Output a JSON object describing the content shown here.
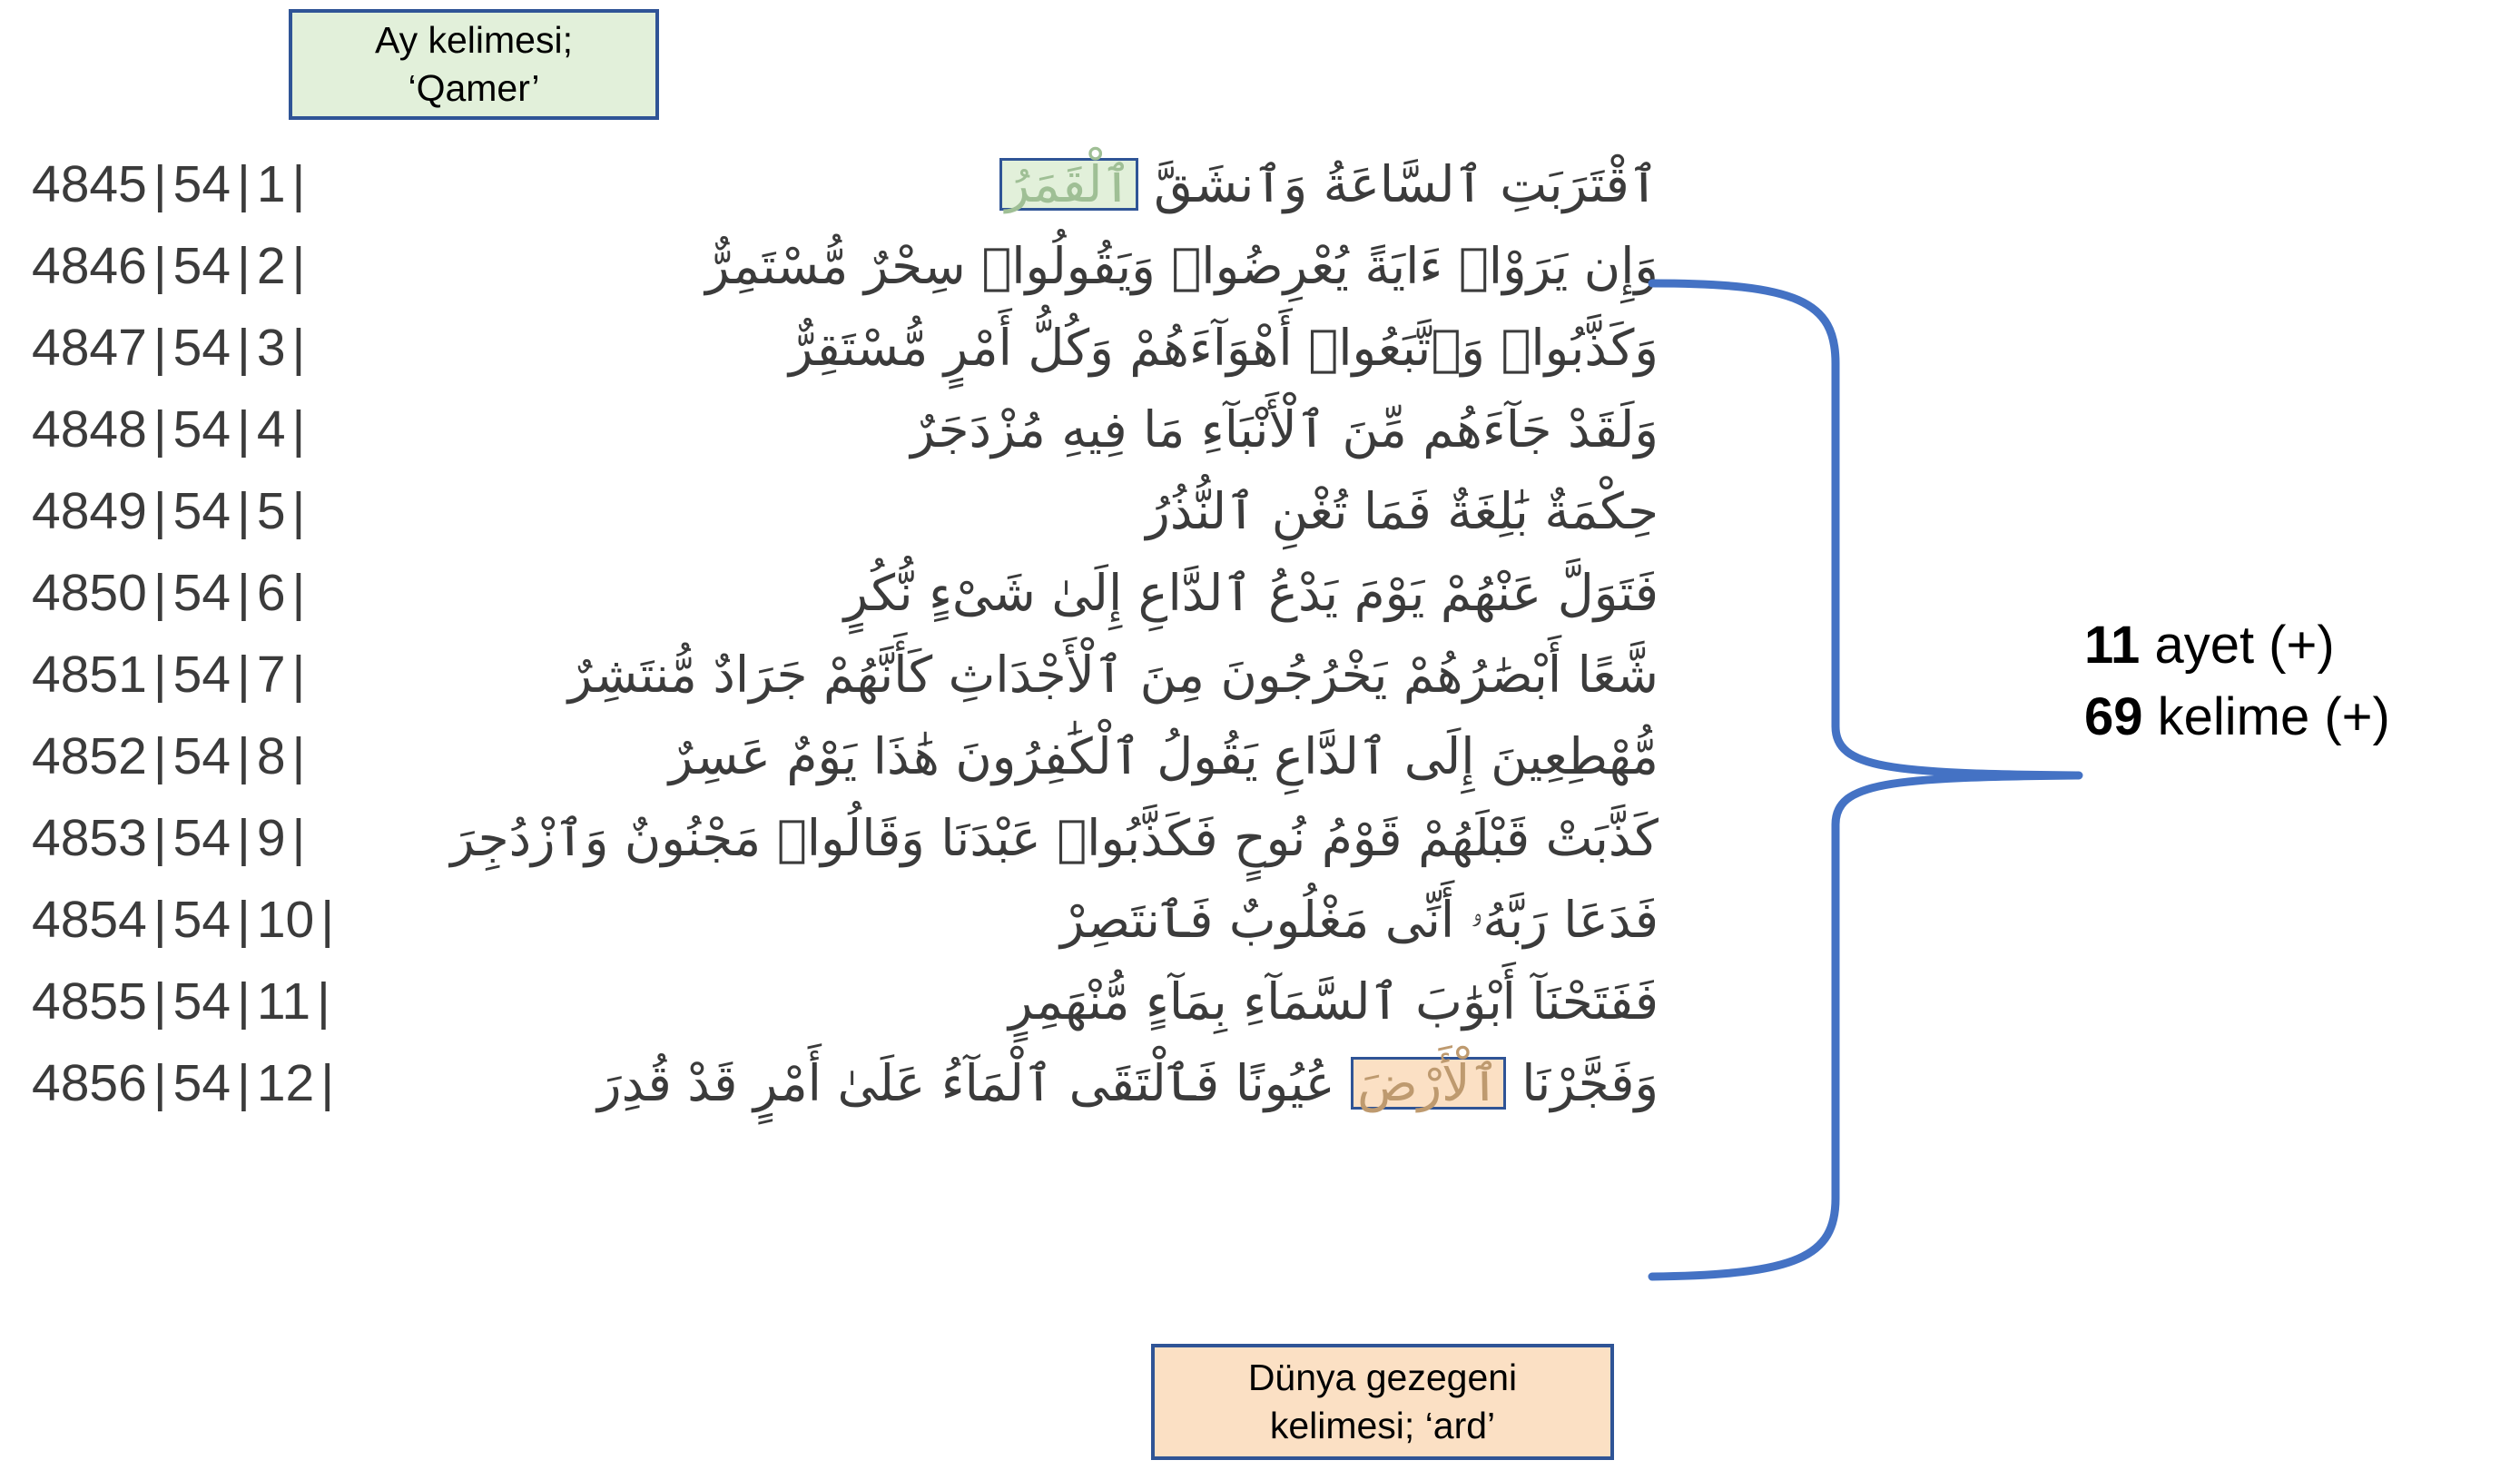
{
  "callouts": {
    "moon": {
      "line1": "Ay kelimesi;",
      "line2": "‘Qamer’",
      "fill": "#E2F0DA",
      "border": "#2F5496"
    },
    "earth": {
      "line1": "Dünya gezegeni",
      "line2": "kelimesi; ‘ard’",
      "fill": "#FBE0C4",
      "border": "#2F5496"
    }
  },
  "summary": {
    "ayet_count": "11",
    "ayet_label": " ayet (+)",
    "kelime_count": "69",
    "kelime_label": " kelime (+)"
  },
  "brace": {
    "color": "#4472C4"
  },
  "verses": [
    {
      "index": "4845",
      "surah": "54",
      "ayah": "1",
      "pre": "ٱقْتَرَبَتِ ٱلسَّاعَةُ وَٱنشَقَّ ",
      "highlight": "ٱلْقَمَرُ",
      "highlight_kind": "green",
      "post": ""
    },
    {
      "index": "4846",
      "surah": "54",
      "ayah": "2",
      "pre": "وَإِن يَرَوْاۡ ءَايَةً يُعْرِضُواۡ وَيَقُولُواۡ سِحْرٌ مُّسْتَمِرٌّ",
      "highlight": "",
      "highlight_kind": "",
      "post": ""
    },
    {
      "index": "4847",
      "surah": "54",
      "ayah": "3",
      "pre": "وَكَذَّبُواۡ وَٱتَّبَعُواۡ أَهْوَآءَهُمْ وَكُلُّ أَمْرٍ مُّسْتَقِرٌّ",
      "highlight": "",
      "highlight_kind": "",
      "post": ""
    },
    {
      "index": "4848",
      "surah": "54",
      "ayah": "4",
      "pre": "وَلَقَدْ جَآءَهُم مِّنَ ٱلْأَنْبَآءِ مَا فِيهِ مُزْدَجَرٌ",
      "highlight": "",
      "highlight_kind": "",
      "post": ""
    },
    {
      "index": "4849",
      "surah": "54",
      "ayah": "5",
      "pre": "حِكْمَةٌ بَٰلِغَةٌ فَمَا تُغْنِ ٱلنُّذُرُ",
      "highlight": "",
      "highlight_kind": "",
      "post": ""
    },
    {
      "index": "4850",
      "surah": "54",
      "ayah": "6",
      "pre": "فَتَوَلَّ عَنْهُمْ يَوْمَ يَدْعُ ٱلدَّاعِ إِلَىٰ شَىْءٍ نُّكُرٍ",
      "highlight": "",
      "highlight_kind": "",
      "post": ""
    },
    {
      "index": "4851",
      "surah": "54",
      "ayah": "7",
      "pre": "شَّعًا أَبْصَٰرُهُمْ يَخْرُجُونَ مِنَ ٱلْأَجْدَاثِ كَأَنَّهُمْ جَرَادٌ مُّنتَشِرٌ",
      "highlight": "",
      "highlight_kind": "",
      "post": ""
    },
    {
      "index": "4852",
      "surah": "54",
      "ayah": "8",
      "pre": "مُّهْطِعِينَ إِلَى ٱلدَّاعِ يَقُولُ ٱلْكَٰفِرُونَ هَٰذَا يَوْمٌ عَسِرٌ",
      "highlight": "",
      "highlight_kind": "",
      "post": ""
    },
    {
      "index": "4853",
      "surah": "54",
      "ayah": "9",
      "pre": "كَذَّبَتْ قَبْلَهُمْ قَوْمُ نُوحٍ فَكَذَّبُواۡ عَبْدَنَا وَقَالُواۡ مَجْنُونٌ وَٱزْدُجِرَ",
      "highlight": "",
      "highlight_kind": "",
      "post": ""
    },
    {
      "index": "4854",
      "surah": "54",
      "ayah": "10",
      "pre": "فَدَعَا رَبَّهُۥ أَنِّى مَغْلُوبٌ فَٱنتَصِرْ",
      "highlight": "",
      "highlight_kind": "",
      "post": ""
    },
    {
      "index": "4855",
      "surah": "54",
      "ayah": "11",
      "pre": "فَفَتَحْنَآ أَبْوَٰبَ ٱلسَّمَآءِ بِمَآءٍ مُّنْهَمِرٍ",
      "highlight": "",
      "highlight_kind": "",
      "post": ""
    },
    {
      "index": "4856",
      "surah": "54",
      "ayah": "12",
      "pre": "وَفَجَّرْنَا ",
      "highlight": "ٱلْأَرْضَ",
      "highlight_kind": "orange",
      "post": " عُيُونًا فَٱلْتَقَى ٱلْمَآءُ عَلَىٰ أَمْرٍ قَدْ قُدِرَ"
    }
  ]
}
